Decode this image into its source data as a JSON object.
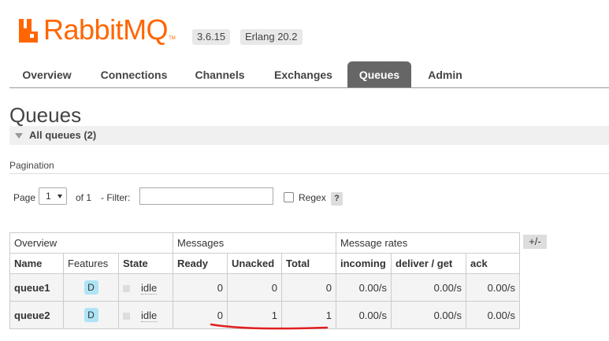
{
  "app": {
    "logo_text": "RabbitMQ",
    "logo_tm": "TM",
    "version": "3.6.15",
    "erlang": "Erlang 20.2",
    "accent_color": "#ff6600"
  },
  "tabs": [
    "Overview",
    "Connections",
    "Channels",
    "Exchanges",
    "Queues",
    "Admin"
  ],
  "active_tab": "Queues",
  "page": {
    "title": "Queues",
    "section": "All queues (2)"
  },
  "pagination": {
    "title": "Pagination",
    "page_label": "Page",
    "page_value": "1",
    "of_label": "of 1",
    "filter_label": "- Filter:",
    "filter_value": "",
    "regex_label": "Regex",
    "help_label": "?"
  },
  "table": {
    "groups": [
      "Overview",
      "Messages",
      "Message rates"
    ],
    "toggle_label": "+/-",
    "columns": [
      "Name",
      "Features",
      "State",
      "Ready",
      "Unacked",
      "Total",
      "incoming",
      "deliver / get",
      "ack"
    ],
    "rows": [
      {
        "name": "queue1",
        "feature": "D",
        "state": "idle",
        "ready": "0",
        "unacked": "0",
        "total": "0",
        "incoming": "0.00/s",
        "deliver_get": "0.00/s",
        "ack": "0.00/s"
      },
      {
        "name": "queue2",
        "feature": "D",
        "state": "idle",
        "ready": "0",
        "unacked": "1",
        "total": "1",
        "incoming": "0.00/s",
        "deliver_get": "0.00/s",
        "ack": "0.00/s"
      }
    ]
  }
}
